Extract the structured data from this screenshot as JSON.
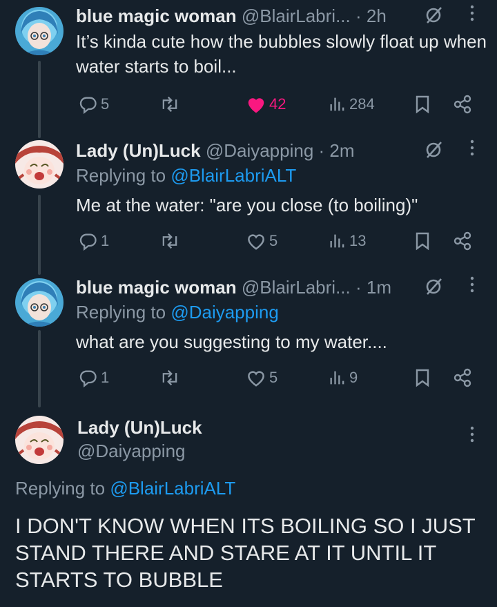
{
  "tweets": [
    {
      "name": "blue magic woman",
      "handle": "@BlairLabri...",
      "time": "· 2h",
      "replying_prefix": "",
      "replying_to": "",
      "text": "It’s kinda cute how the bubbles slowly float up when water starts to boil...",
      "replies": "5",
      "retweets": "",
      "likes": "42",
      "views": "284"
    },
    {
      "name": "Lady (Un)Luck",
      "handle": "@Daiyapping",
      "time": "· 2m",
      "replying_prefix": "Replying to",
      "replying_to": "@BlairLabriALT",
      "text": "Me at the water: \"are you close (to boiling)\"",
      "replies": "1",
      "retweets": "",
      "likes": "5",
      "views": "13"
    },
    {
      "name": "blue magic woman",
      "handle": "@BlairLabri...",
      "time": "· 1m",
      "replying_prefix": "Replying to",
      "replying_to": "@Daiyapping",
      "text": "what are you suggesting to my water....",
      "replies": "1",
      "retweets": "",
      "likes": "5",
      "views": "9"
    }
  ],
  "main": {
    "name": "Lady (Un)Luck",
    "handle": "@Daiyapping",
    "replying_prefix": "Replying to",
    "replying_to": "@BlairLabriALT",
    "text": "I DON'T KNOW WHEN ITS BOILING SO I JUST STAND THERE AND STARE AT IT UNTIL IT STARTS TO BUBBLE"
  },
  "colors": {
    "background": "#15202b",
    "muted": "#8b98a5",
    "link": "#1d9bf0",
    "like": "#f91880",
    "thread_line": "#38444d"
  }
}
